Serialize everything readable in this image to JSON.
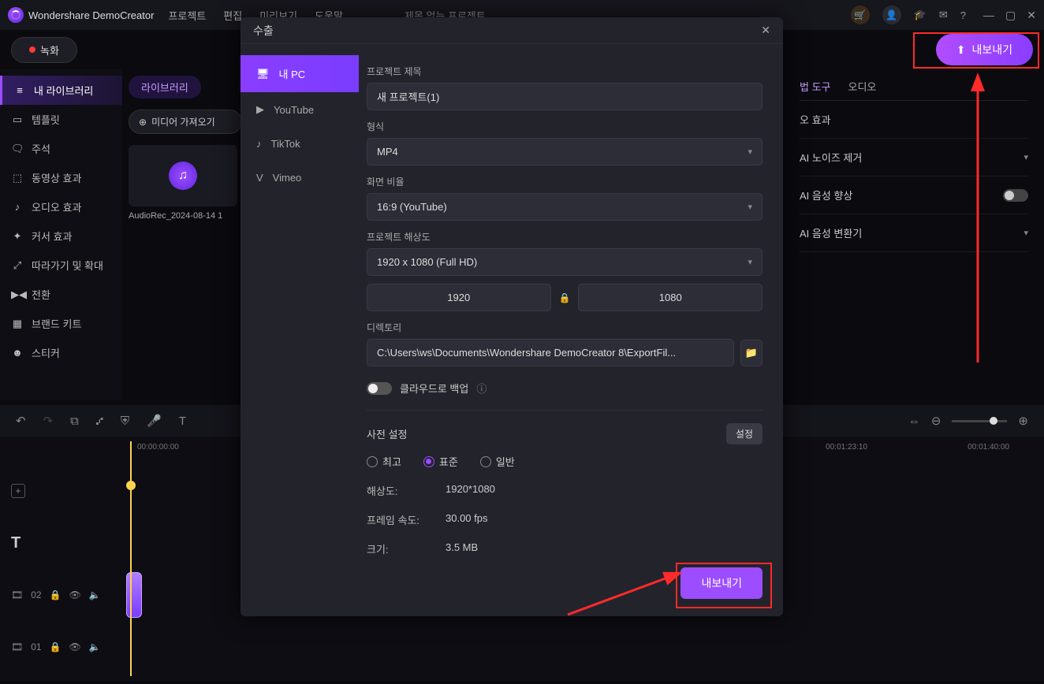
{
  "app": {
    "name": "Wondershare DemoCreator",
    "project": "제목 없는 프로젝트"
  },
  "menu": {
    "project": "프로젝트",
    "edit": "편집",
    "preview": "미리보기",
    "help": "도움말"
  },
  "buttons": {
    "record": "녹화",
    "export_top": "내보내기",
    "export_modal": "내보내기",
    "import": "미디어 가져오기",
    "settings": "설정"
  },
  "sidebar": {
    "items": [
      {
        "icon": "≡",
        "label": "내 라이브러리"
      },
      {
        "icon": "▭",
        "label": "템플릿"
      },
      {
        "icon": "🗨",
        "label": "주석"
      },
      {
        "icon": "⬚",
        "label": "동영상 효과"
      },
      {
        "icon": "♪",
        "label": "오디오 효과"
      },
      {
        "icon": "✦",
        "label": "커서 효과"
      },
      {
        "icon": "⤢",
        "label": "따라가기 및 확대"
      },
      {
        "icon": "▶◀",
        "label": "전환"
      },
      {
        "icon": "▦",
        "label": "브랜드 키트"
      },
      {
        "icon": "☻",
        "label": "스티커"
      }
    ]
  },
  "library": {
    "tab": "라이브러리",
    "clipname": "AudioRec_2024-08-14 1"
  },
  "rightpanel": {
    "tab1": "법 도구",
    "tab2": "오디오",
    "row1": "오 효과",
    "noise": "AI 노이즈 제거",
    "enhance": "AI 음성 향상",
    "voice": "AI 음성 변환기"
  },
  "timeline": {
    "t0": "00:00:00:00",
    "t1": "00:01:23:10",
    "t2": "00:01:40:00",
    "track1": "02",
    "track2": "01"
  },
  "modal": {
    "title": "수출",
    "tabs": {
      "pc": "내 PC",
      "yt": "YouTube",
      "tt": "TikTok",
      "vm": "Vimeo"
    },
    "labels": {
      "title": "프로젝트 제목",
      "format": "형식",
      "ratio": "화면 비율",
      "res": "프로젝트 해상도",
      "dir": "디렉토리",
      "cloud": "클라우드로 백업",
      "preset": "사전 설정",
      "reso": "해상도:",
      "fps": "프레임 속도:",
      "size": "크기:"
    },
    "values": {
      "title": "새 프로젝트(1)",
      "format": "MP4",
      "ratio": "16:9 (YouTube)",
      "res": "1920 x 1080 (Full HD)",
      "w": "1920",
      "h": "1080",
      "dir": "C:\\Users\\ws\\Documents\\Wondershare DemoCreator 8\\ExportFil...",
      "reso": "1920*1080",
      "fps": "30.00 fps",
      "size": "3.5 MB"
    },
    "radios": {
      "best": "최고",
      "std": "표준",
      "norm": "일반"
    }
  }
}
